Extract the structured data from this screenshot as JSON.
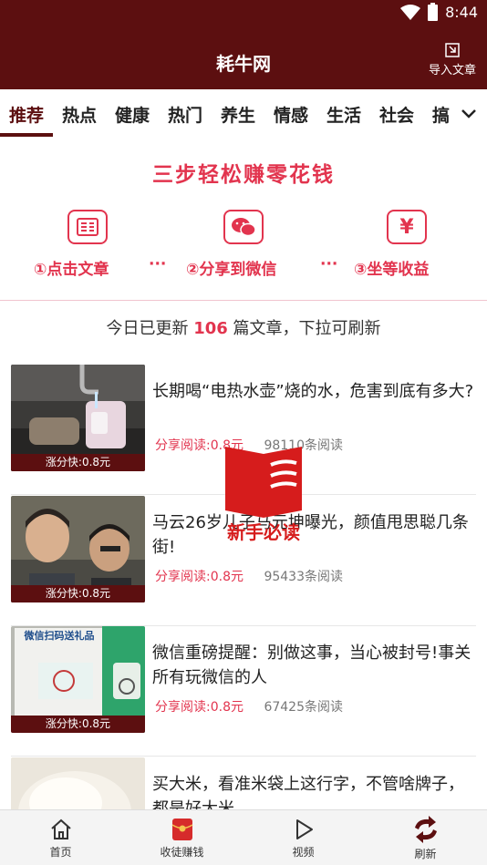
{
  "status": {
    "time": "8:44"
  },
  "header": {
    "title": "耗牛网",
    "import_label": "导入文章"
  },
  "tabs": [
    {
      "label": "推荐",
      "active": true
    },
    {
      "label": "热点"
    },
    {
      "label": "健康"
    },
    {
      "label": "热门"
    },
    {
      "label": "养生"
    },
    {
      "label": "情感"
    },
    {
      "label": "生活"
    },
    {
      "label": "社会"
    },
    {
      "label": "搞"
    }
  ],
  "banner": {
    "title": "三步轻松赚零花钱",
    "steps": [
      {
        "label": "①点击文章",
        "icon": "article-icon"
      },
      {
        "label": "②分享到微信",
        "icon": "wechat-icon"
      },
      {
        "label": "③坐等收益",
        "icon": "yuan-icon"
      }
    ],
    "dots": "···"
  },
  "update": {
    "prefix": "今日已更新 ",
    "count": "106",
    "suffix": " 篇文章，下拉可刷新"
  },
  "articles": [
    {
      "title": "长期喝“电热水壶”烧的水，危害到底有多大?",
      "tag": "涨分快:0.8元",
      "share": "分享阅读:0.8元",
      "reads": "98110条阅读"
    },
    {
      "title": "马云26岁儿子马元坤曝光，颜值甩思聪几条街!",
      "tag": "涨分快:0.8元",
      "share": "分享阅读:0.8元",
      "reads": "95433条阅读"
    },
    {
      "title": "微信重磅提醒：别做这事，当心被封号!事关所有玩微信的人",
      "tag": "涨分快:0.8元",
      "share": "分享阅读:0.8元",
      "reads": "67425条阅读",
      "thumb_text": "微信扫码送礼品"
    },
    {
      "title": "买大米，看准米袋上这行字，不管啥牌子，都是好大米"
    }
  ],
  "floating_badge": {
    "label": "新手必读"
  },
  "bottom_nav": [
    {
      "label": "首页",
      "icon": "home-icon"
    },
    {
      "label": "收徒赚钱",
      "icon": "red-envelope-icon"
    },
    {
      "label": "视频",
      "icon": "play-icon"
    },
    {
      "label": "刷新",
      "icon": "refresh-icon"
    }
  ],
  "colors": {
    "brand": "#5c0f10",
    "accent": "#e2344e",
    "badge": "#d61c1c"
  }
}
